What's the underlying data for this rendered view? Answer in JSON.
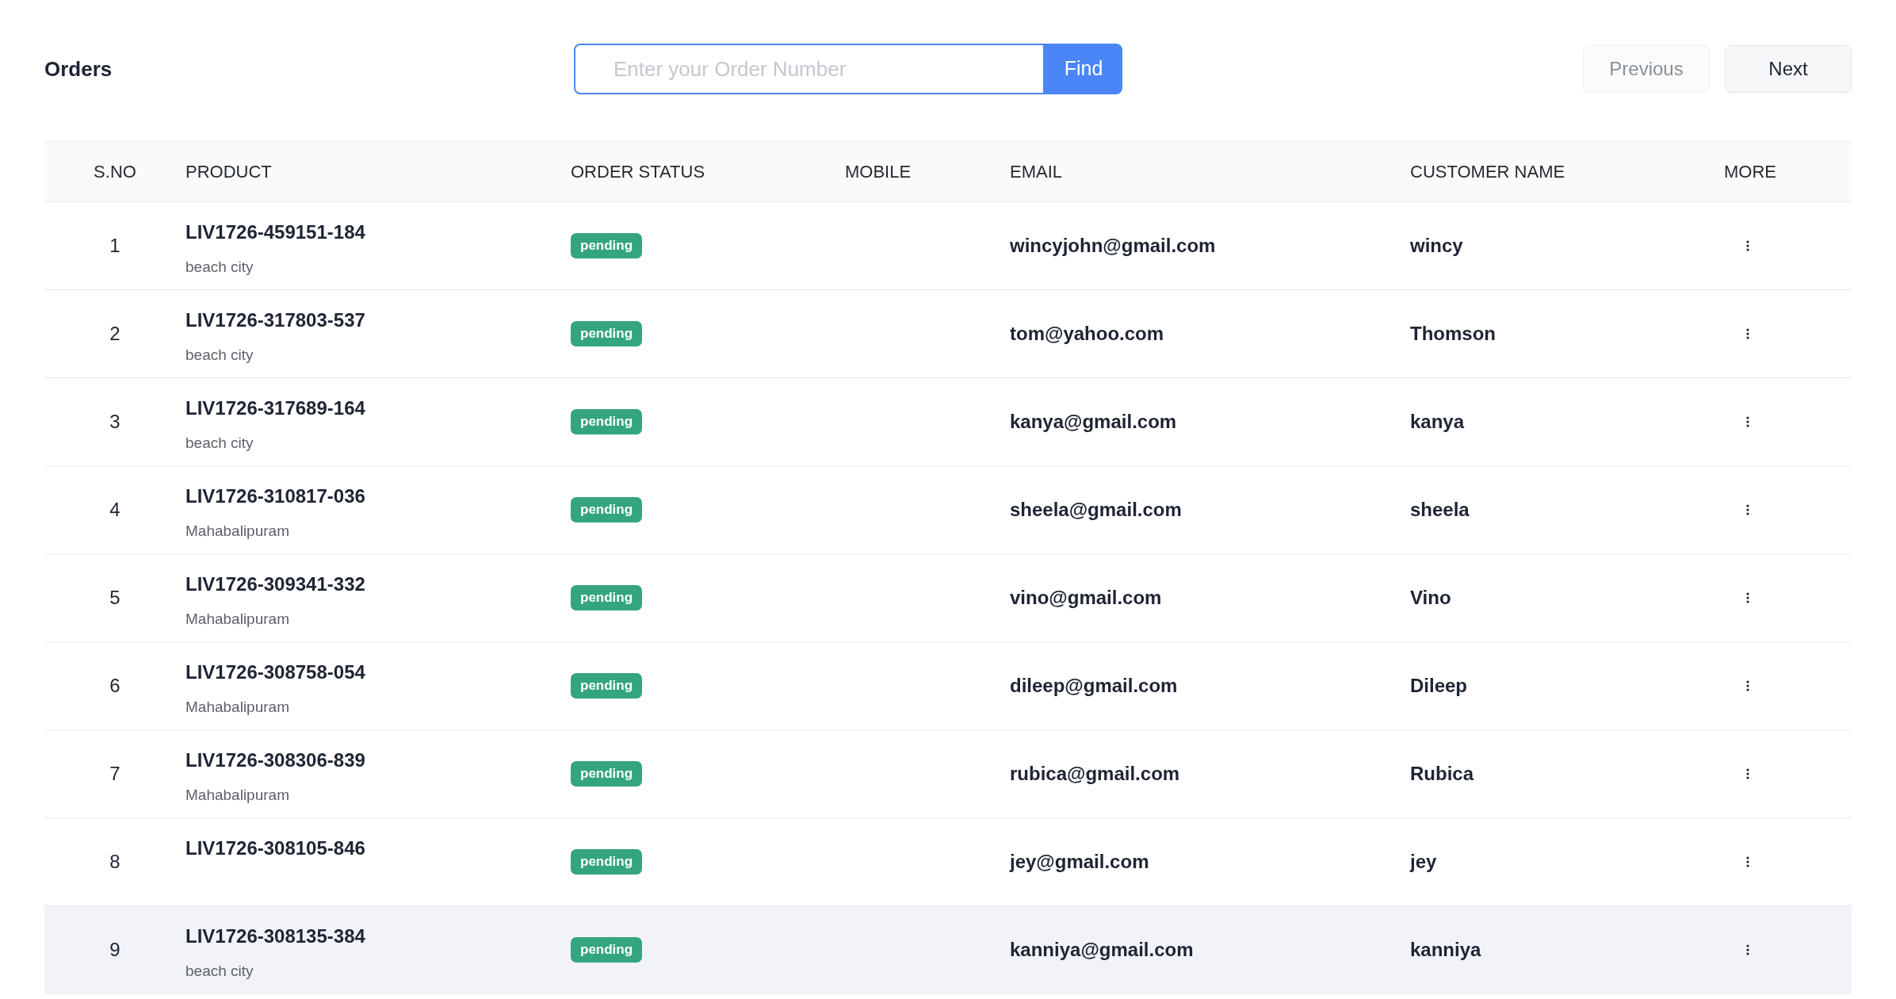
{
  "title": "Orders",
  "search": {
    "placeholder": "Enter your Order Number",
    "button": "Find"
  },
  "pagination": [
    {
      "label": "Previous",
      "disabled": true
    },
    {
      "label": "Next",
      "disabled": false
    }
  ],
  "table": {
    "columns": [
      "S.NO",
      "PRODUCT",
      "ORDER STATUS",
      "MOBILE",
      "EMAIL",
      "CUSTOMER NAME",
      "MORE"
    ],
    "rows": [
      {
        "sno": "1",
        "product": "LIV1726-459151-184",
        "location": "beach city",
        "status": "pending",
        "email": "wincyjohn@gmail.com",
        "customer": "wincy",
        "selected": false
      },
      {
        "sno": "2",
        "product": "LIV1726-317803-537",
        "location": "beach city",
        "status": "pending",
        "email": "tom@yahoo.com",
        "customer": "Thomson",
        "selected": false
      },
      {
        "sno": "3",
        "product": "LIV1726-317689-164",
        "location": "beach city",
        "status": "pending",
        "email": "kanya@gmail.com",
        "customer": "kanya",
        "selected": false
      },
      {
        "sno": "4",
        "product": "LIV1726-310817-036",
        "location": "Mahabalipuram",
        "status": "pending",
        "email": "sheela@gmail.com",
        "customer": "sheela",
        "selected": false
      },
      {
        "sno": "5",
        "product": "LIV1726-309341-332",
        "location": "Mahabalipuram",
        "status": "pending",
        "email": "vino@gmail.com",
        "customer": "Vino",
        "selected": false
      },
      {
        "sno": "6",
        "product": "LIV1726-308758-054",
        "location": "Mahabalipuram",
        "status": "pending",
        "email": "dileep@gmail.com",
        "customer": "Dileep",
        "selected": false
      },
      {
        "sno": "7",
        "product": "LIV1726-308306-839",
        "location": "Mahabalipuram",
        "status": "pending",
        "email": "rubica@gmail.com",
        "customer": "Rubica",
        "selected": false
      },
      {
        "sno": "8",
        "product": "LIV1726-308105-846",
        "status": "pending",
        "email": "jey@gmail.com",
        "customer": "jey",
        "selected": false
      },
      {
        "sno": "9",
        "product": "LIV1726-308135-384",
        "location": "beach city",
        "status": "pending",
        "email": "kanniya@gmail.com",
        "customer": "kanniya",
        "selected": true
      }
    ]
  }
}
